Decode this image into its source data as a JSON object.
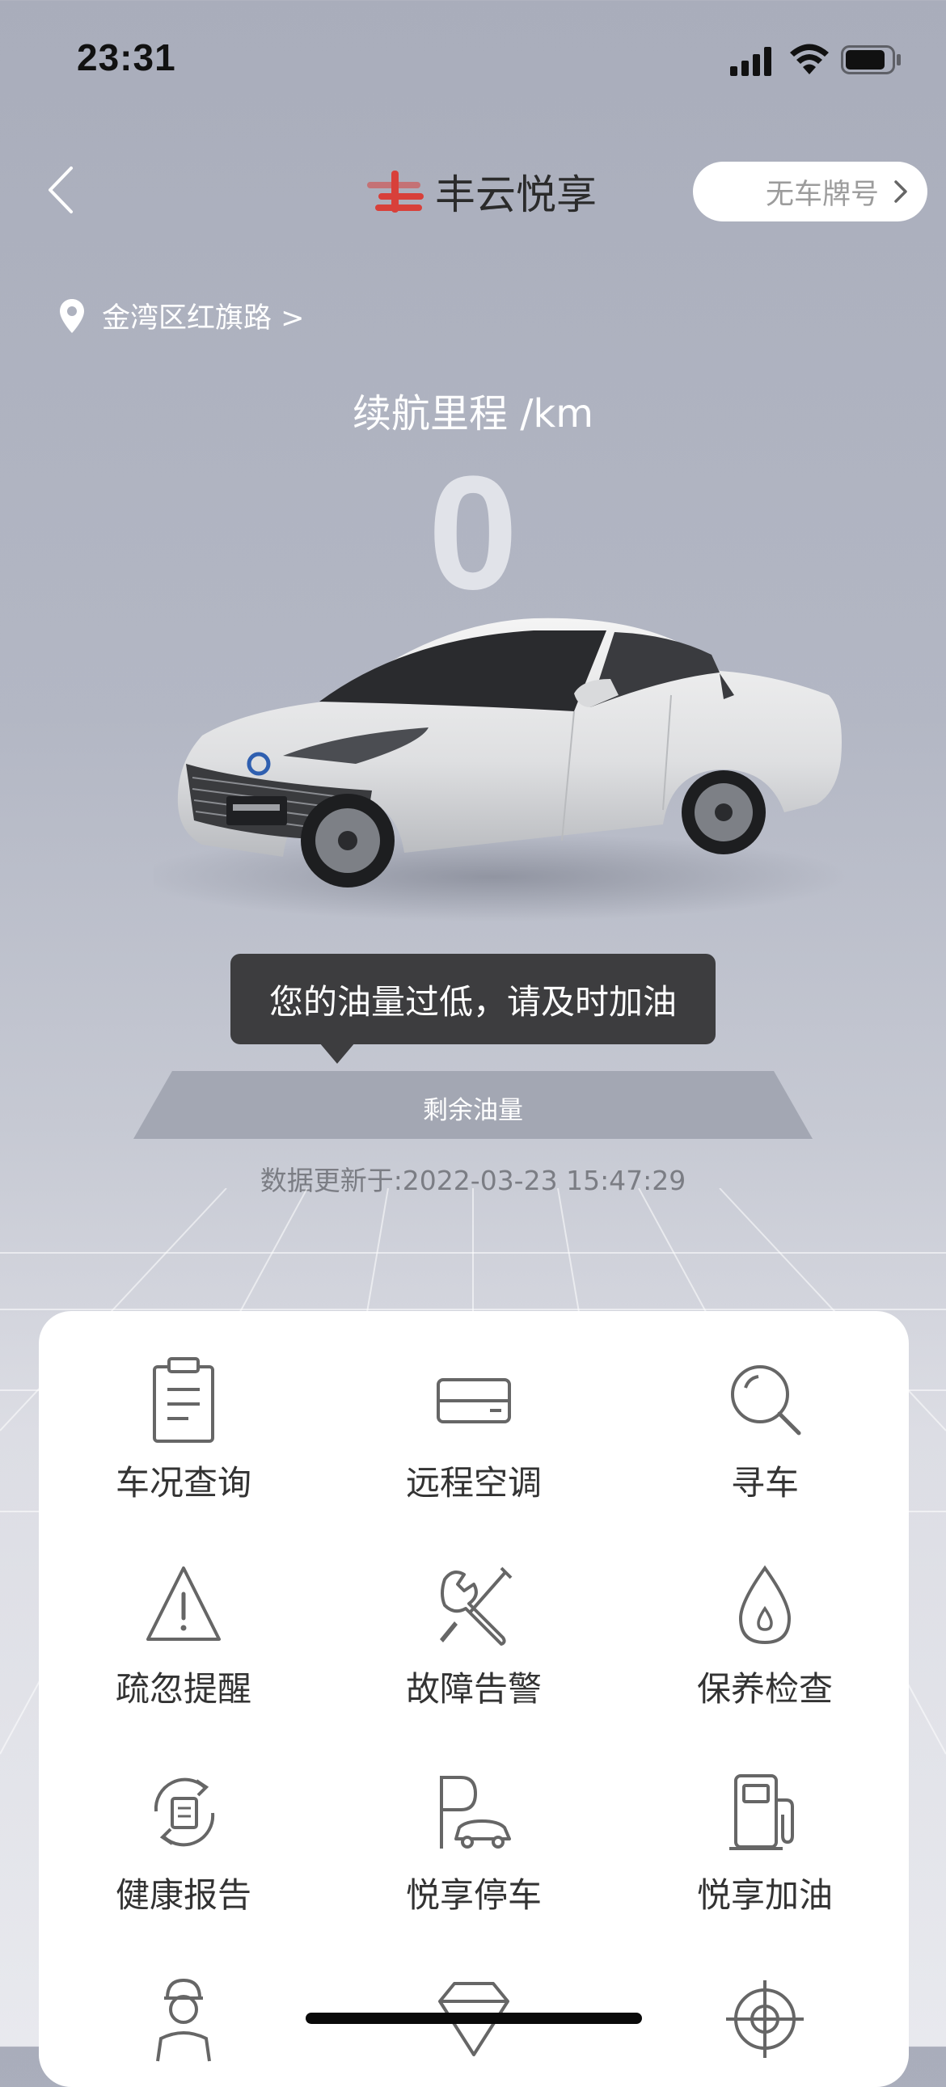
{
  "status_bar": {
    "time": "23:31"
  },
  "header": {
    "brand_name": "丰云悦享",
    "plate_button_label": "无车牌号"
  },
  "location": {
    "address": "金湾区红旗路 >"
  },
  "vehicle": {
    "range_title": "续航里程 /km",
    "range_value": "0",
    "fuel_tooltip": "您的油量过低，请及时加油",
    "fuel_label": "剩余油量",
    "update_text": "数据更新于:2022-03-23 15:47:29"
  },
  "functions": {
    "items": [
      {
        "label": "车况查询",
        "icon": "clipboard-icon"
      },
      {
        "label": "远程空调",
        "icon": "aircon-icon"
      },
      {
        "label": "寻车",
        "icon": "search-icon"
      },
      {
        "label": "疏忽提醒",
        "icon": "warning-icon"
      },
      {
        "label": "故障告警",
        "icon": "tools-icon"
      },
      {
        "label": "保养检查",
        "icon": "oil-drop-icon"
      },
      {
        "label": "健康报告",
        "icon": "health-report-icon"
      },
      {
        "label": "悦享停车",
        "icon": "parking-icon"
      },
      {
        "label": "悦享加油",
        "icon": "fuel-pump-icon"
      },
      {
        "label": "",
        "icon": "service-person-icon"
      },
      {
        "label": "",
        "icon": "diamond-icon"
      },
      {
        "label": "",
        "icon": "target-icon"
      }
    ]
  }
}
